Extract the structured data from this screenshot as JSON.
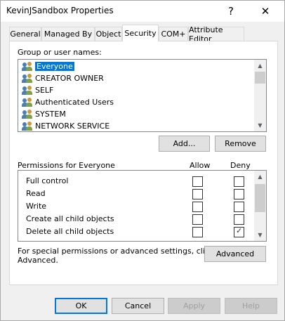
{
  "window": {
    "title": "KevinJSandbox Properties",
    "help_glyph": "?",
    "close_glyph": "✕"
  },
  "tabs": [
    {
      "label": "General"
    },
    {
      "label": "Managed By"
    },
    {
      "label": "Object"
    },
    {
      "label": "Security",
      "active": true
    },
    {
      "label": "COM+"
    },
    {
      "label": "Attribute Editor"
    }
  ],
  "security": {
    "group_label": "Group or user names:",
    "users": [
      {
        "name": "Everyone",
        "selected": true
      },
      {
        "name": "CREATOR OWNER"
      },
      {
        "name": "SELF"
      },
      {
        "name": "Authenticated Users"
      },
      {
        "name": "SYSTEM"
      },
      {
        "name": "NETWORK SERVICE"
      }
    ],
    "add_label": "Add...",
    "remove_label": "Remove",
    "permissions_label": "Permissions for Everyone",
    "allow_header": "Allow",
    "deny_header": "Deny",
    "permissions": [
      {
        "name": "Full control",
        "allow": false,
        "deny": false
      },
      {
        "name": "Read",
        "allow": false,
        "deny": false
      },
      {
        "name": "Write",
        "allow": false,
        "deny": false
      },
      {
        "name": "Create all child objects",
        "allow": false,
        "deny": false
      },
      {
        "name": "Delete all child objects",
        "allow": false,
        "deny": true
      }
    ],
    "special_text_line1": "For special permissions or advanced settings, click",
    "special_text_line2": "Advanced.",
    "advanced_label": "Advanced"
  },
  "footer": {
    "ok_label": "OK",
    "cancel_label": "Cancel",
    "apply_label": "Apply",
    "help_label": "Help"
  },
  "icons": {
    "user_group_icon": "user-group-icon",
    "scroll_up": "▲",
    "scroll_down": "▼",
    "check": "✓"
  }
}
